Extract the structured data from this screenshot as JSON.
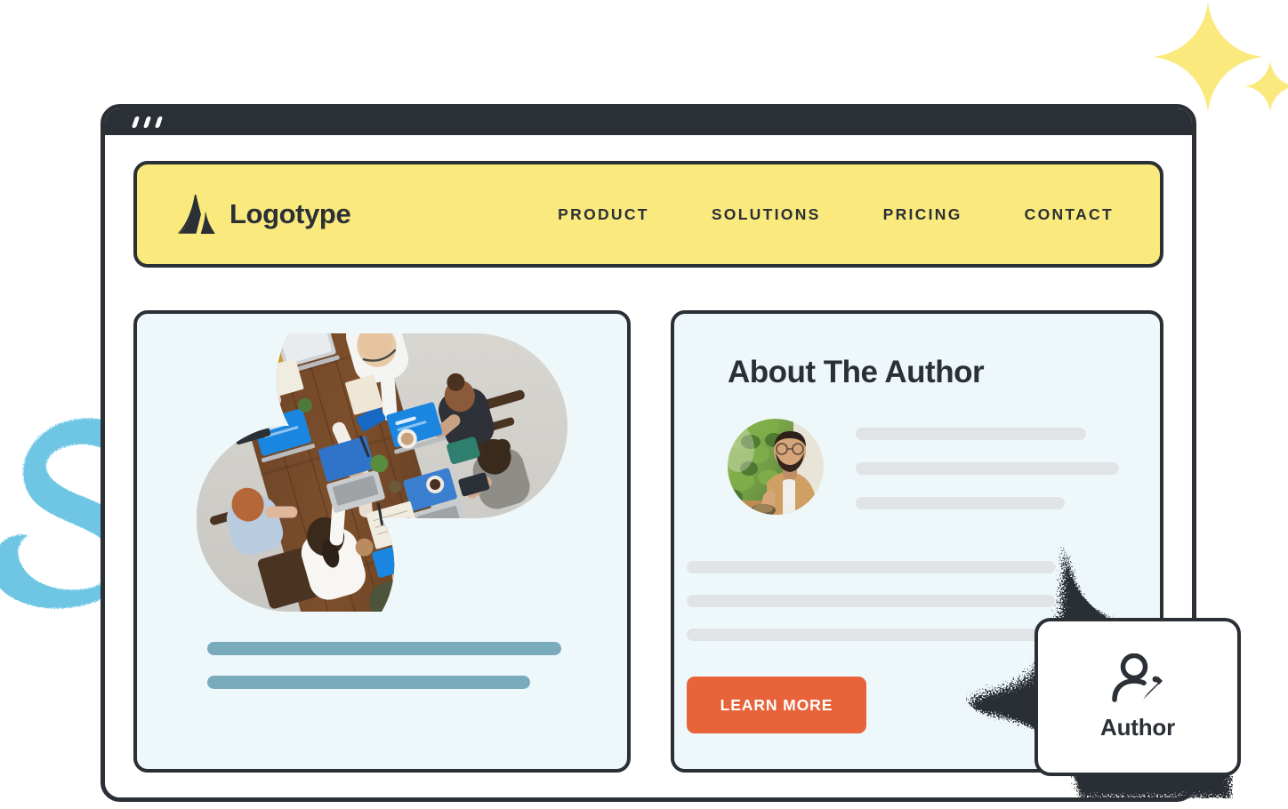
{
  "window": {
    "dots_count": 3,
    "chrome_color": "#2b2f36"
  },
  "header": {
    "background_color": "#fae97d",
    "brand": {
      "logo_icon": "mountain-peak-logo-icon",
      "name": "Logotype"
    },
    "nav_items": [
      {
        "label": "PRODUCT"
      },
      {
        "label": "SOLUTIONS"
      },
      {
        "label": "PRICING"
      },
      {
        "label": "CONTACT"
      }
    ]
  },
  "article_card": {
    "background_color": "#eef8fb",
    "photo_alt": "team-meeting-top-down-photo",
    "text_lines": [
      {
        "width_label": "long"
      },
      {
        "width_label": "medium"
      }
    ],
    "line_color": "#7aabbd"
  },
  "author_card": {
    "background_color": "#eef8fb",
    "title": "About The Author",
    "avatar_alt": "author-portrait-photo",
    "bio_lines": 3,
    "body_lines": 3,
    "placeholder_color": "#e1e4e6",
    "cta": {
      "label": "LEARN MORE",
      "color": "#e8633a",
      "text_color": "#ffffff"
    }
  },
  "author_badge": {
    "icon": "person-edit-author-icon",
    "label": "Author",
    "border_color": "#2b2f36"
  },
  "decorations": {
    "sparkles": [
      {
        "name": "sparkle-large",
        "color": "#fae97d"
      },
      {
        "name": "sparkle-small",
        "color": "#fae97d"
      }
    ],
    "squiggle": {
      "name": "blue-s-squiggle",
      "color": "#6ec6e4"
    },
    "burst": {
      "name": "dark-sparkle-burst",
      "color": "#2b2f36"
    }
  }
}
